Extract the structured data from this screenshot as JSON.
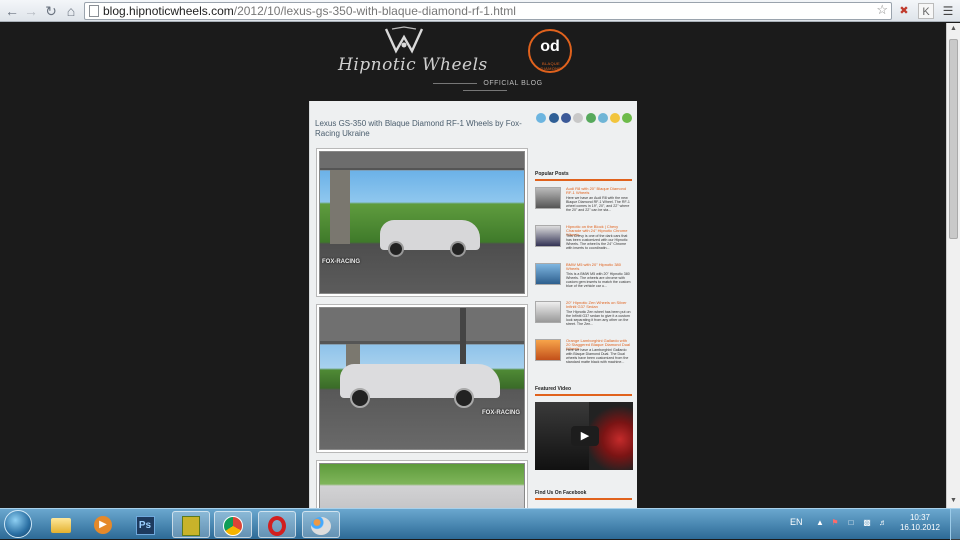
{
  "browser": {
    "url_host": "blog.hipnoticwheels.com",
    "url_path": "/2012/10/lexus-gs-350-with-blaque-diamond-rf-1.html"
  },
  "header": {
    "logo_text": "Hipnotic Wheels",
    "od_logo_text": "od",
    "od_logo_sub": "BLAQUE DIAMOND",
    "tagline": "OFFICIAL BLOG"
  },
  "post": {
    "title": "Lexus GS-350 with Blaque Diamond RF-1 Wheels by Fox-Racing Ukraine",
    "watermark": "FOX-RACING"
  },
  "sidebar": {
    "popular_title": "Popular Posts",
    "popular_posts": [
      {
        "title": "Audi R8 with 20\" Blaque Diamond RF-1 Wheels",
        "excerpt": "Here we have an Audi R8 with the new Blaque Diamond RF-1 Wheel. The RF-1 wheel comes in 19\", 20\", and 22\" where the 20\" and 22\" can be sta..."
      },
      {
        "title": "Hipnotic on the Block | Chevy Charade with 24\" Hipnotic Chrome Wheels",
        "excerpt": "This Chevy is one of the dark cars that has been customized with our Hipnotic Wheels. The wheel is the 24\" Chrome with inserts to coordinatin..."
      },
      {
        "title": "BMW M5 with 20\" Hipnotic 380 Wheels",
        "excerpt": "This is a BMW M5 with 20\" Hipnotic 380 Wheels. The wheels are chrome with custom gem inserts to match the custom blue of the vehicle car u..."
      },
      {
        "title": "20\" Hipnotic Zen Wheels on Silver Infiniti G37 Sedan",
        "excerpt": "The Hipnotic Zen wheel has been put on the Infiniti G37 sedan to give it a custom look separating it from any other on the street. The Zen..."
      },
      {
        "title": "Orange Lamborghini Gallardo with 20 Staggered Blaque Diamond Dual Wheels",
        "excerpt": "Here we have a Lamborghini Gallardo with Blaque Diamond Dual. The Dual wheels have been customized from the standard matte black with machine..."
      }
    ],
    "video_title": "Featured Video",
    "facebook_title": "Find Us On Facebook"
  },
  "taskbar": {
    "lang": "EN",
    "time": "10:37",
    "date": "16.10.2012"
  },
  "colors": {
    "accent": "#e0621d",
    "page_bg": "#1b1b1b",
    "content_bg": "#eef0f1",
    "title_text": "#4a5d6d"
  },
  "icons": {
    "back": "back-arrow-icon",
    "forward": "forward-arrow-icon",
    "reload": "reload-icon",
    "home": "home-icon",
    "star": "bookmark-star-icon",
    "menu": "chrome-menu-icon",
    "play": "play-icon"
  }
}
